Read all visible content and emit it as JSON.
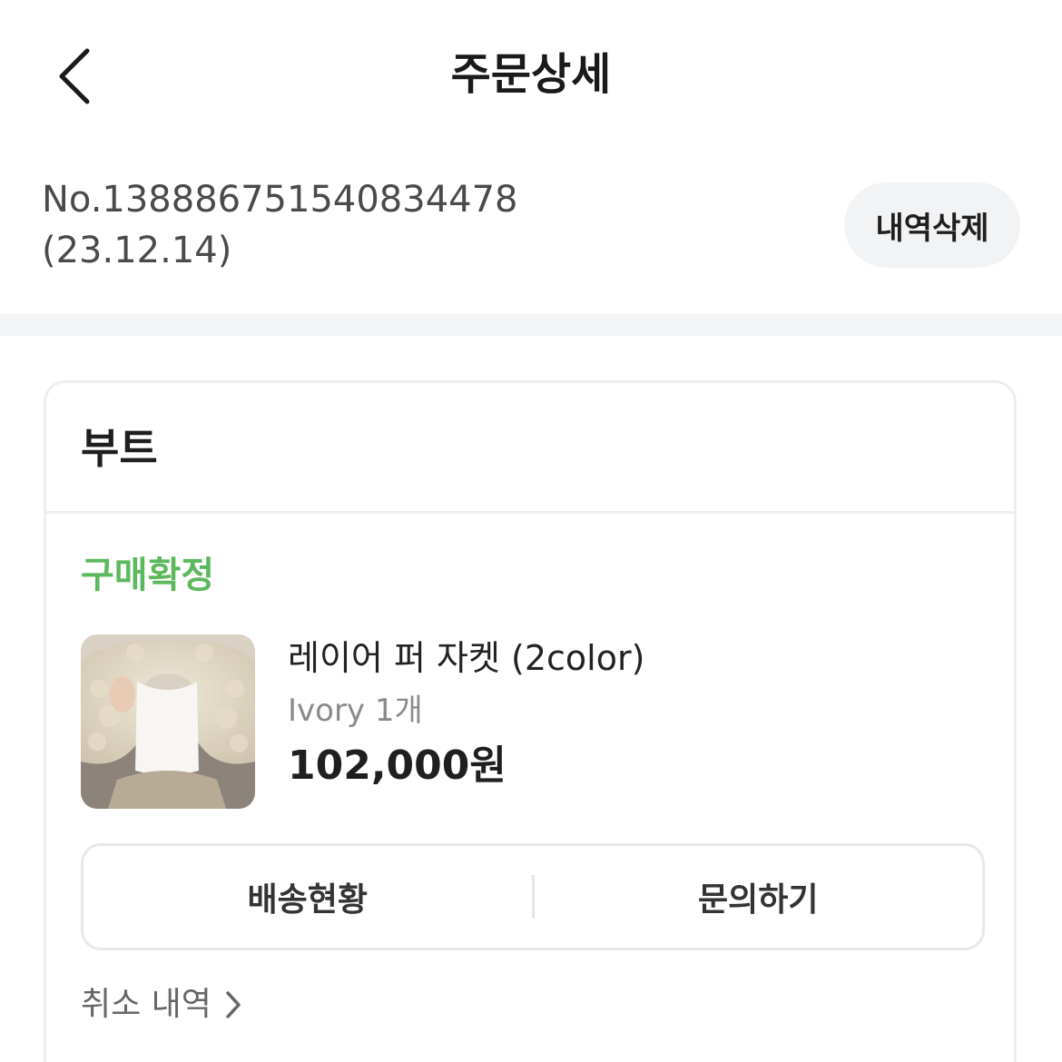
{
  "header": {
    "title": "주문상세",
    "back_icon": "chevron-left-icon"
  },
  "order": {
    "number": "No.13888675154083447​8",
    "date": "(23.12.14)",
    "delete_label": "내역삭제"
  },
  "shop": {
    "name": "부트"
  },
  "item": {
    "status": "구매확정",
    "status_color": "#5cb85c",
    "name": "레이어 퍼 자켓 (2color)",
    "option": "Ivory 1개",
    "price": "102,000원",
    "thumbnail_icon": "product-photo"
  },
  "actions": {
    "shipping_label": "배송현황",
    "inquiry_label": "문의하기"
  },
  "cancel": {
    "label": "취소 내역",
    "icon": "chevron-right-icon"
  }
}
